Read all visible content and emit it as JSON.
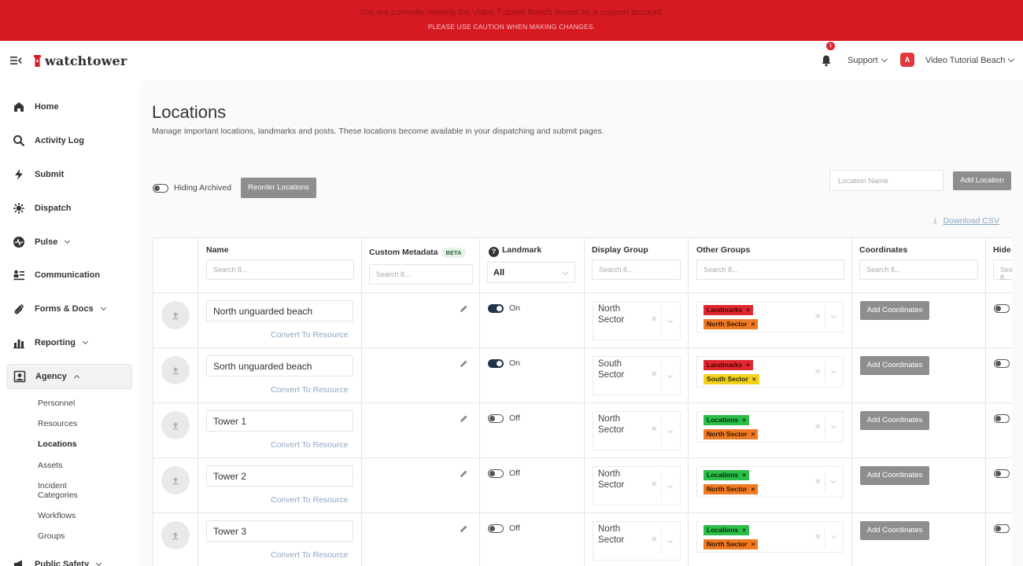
{
  "banner": {
    "line1": "You are currently viewing the Video Tutorial Beach tenant as a support account.",
    "line2": "PLEASE USE CAUTION WHEN MAKING CHANGES."
  },
  "header": {
    "logo_text": "watchtower",
    "notification_count": "1",
    "support_label": "Support",
    "account_initial": "A",
    "account_name": "Video Tutorial Beach"
  },
  "sidebar": {
    "items": [
      {
        "label": "Home"
      },
      {
        "label": "Activity Log"
      },
      {
        "label": "Submit"
      },
      {
        "label": "Dispatch"
      },
      {
        "label": "Pulse"
      },
      {
        "label": "Communication"
      },
      {
        "label": "Forms & Docs"
      },
      {
        "label": "Reporting"
      },
      {
        "label": "Agency"
      },
      {
        "label": "Public Safety"
      }
    ],
    "agency_subitems": [
      {
        "label": "Personnel"
      },
      {
        "label": "Resources"
      },
      {
        "label": "Locations"
      },
      {
        "label": "Assets"
      },
      {
        "label": "Incident Categories"
      },
      {
        "label": "Workflows"
      },
      {
        "label": "Groups"
      }
    ]
  },
  "page": {
    "title": "Locations",
    "description": "Manage important locations, landmarks and posts. These locations become available in your dispatching and submit pages.",
    "archived_toggle_label": "Hiding Archived",
    "reorder_button": "Reorder Locations",
    "location_name_placeholder": "Location Name",
    "add_location_button": "Add Location",
    "download_csv": "Download CSV"
  },
  "table": {
    "columns": {
      "name": "Name",
      "custom_metadata": "Custom Metadata",
      "beta_badge": "BETA",
      "landmark": "Landmark",
      "display_group": "Display Group",
      "other_groups": "Other Groups",
      "coordinates": "Coordinates",
      "hide": "Hide"
    },
    "search_placeholder": "Search 8...",
    "landmark_filter": "All",
    "convert_label": "Convert To Resource",
    "add_coordinates_label": "Add Coordinates",
    "rows": [
      {
        "name": "North unguarded beach",
        "landmark": "On",
        "display_group": "North Sector",
        "tags": [
          {
            "text": "Landmarks",
            "color": "#e0272f"
          },
          {
            "text": "North Sector",
            "color": "#f07a23"
          }
        ]
      },
      {
        "name": "Sorth unguarded beach",
        "landmark": "On",
        "display_group": "South Sector",
        "tags": [
          {
            "text": "Landmarks",
            "color": "#e0272f"
          },
          {
            "text": "South Sector",
            "color": "#f0d21c"
          }
        ]
      },
      {
        "name": "Tower 1",
        "landmark": "Off",
        "display_group": "North Sector",
        "tags": [
          {
            "text": "Locations",
            "color": "#2dbd49"
          },
          {
            "text": "North Sector",
            "color": "#f07a23"
          }
        ]
      },
      {
        "name": "Tower 2",
        "landmark": "Off",
        "display_group": "North Sector",
        "tags": [
          {
            "text": "Locations",
            "color": "#2dbd49"
          },
          {
            "text": "North Sector",
            "color": "#f07a23"
          }
        ]
      },
      {
        "name": "Tower 3",
        "landmark": "Off",
        "display_group": "North Sector",
        "tags": [
          {
            "text": "Locations",
            "color": "#2dbd49"
          },
          {
            "text": "North Sector",
            "color": "#f07a23"
          }
        ]
      }
    ]
  },
  "colors": {
    "banner": "#d51a22",
    "link": "#8aa6c4",
    "button_grey": "#8e8e8e"
  }
}
